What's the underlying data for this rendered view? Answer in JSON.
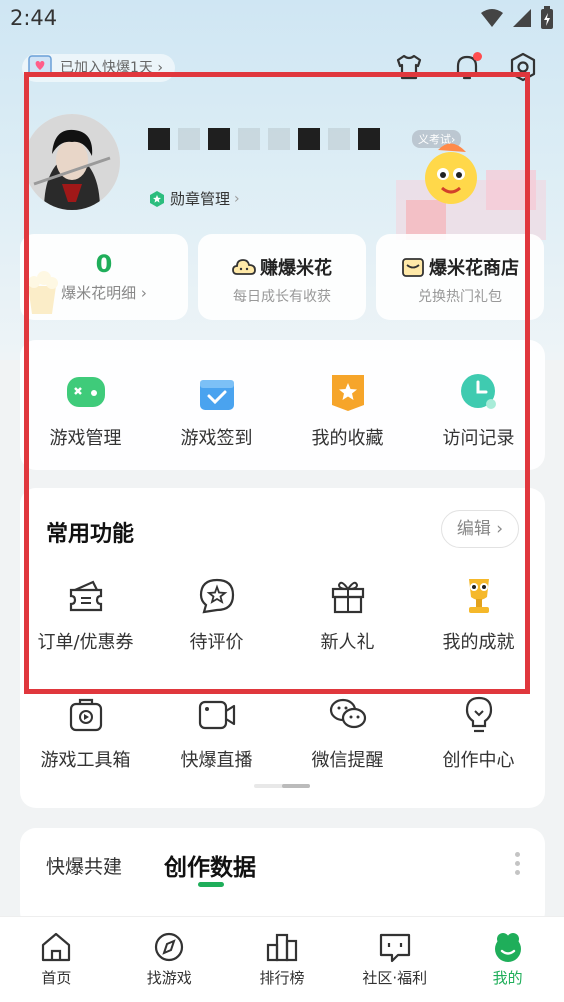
{
  "status_bar": {
    "time": "2:44"
  },
  "header": {
    "join_text": "已加入快爆1天 ›"
  },
  "profile": {
    "vip_tag": "义考试›",
    "medal_label": "勋章管理",
    "medal_arrow": "›"
  },
  "cards": {
    "popcorn_count": "0",
    "popcorn_detail": "爆米花明细 ›",
    "earn_title": "赚爆米花",
    "earn_sub": "每日成长有收获",
    "shop_title": "爆米花商店",
    "shop_sub": "兑换热门礼包"
  },
  "quick": [
    {
      "label": "游戏管理",
      "icon": "gamepad-icon"
    },
    {
      "label": "游戏签到",
      "icon": "gift-checkin-icon"
    },
    {
      "label": "我的收藏",
      "icon": "star-bookmark-icon"
    },
    {
      "label": "访问记录",
      "icon": "clock-history-icon"
    }
  ],
  "common": {
    "title": "常用功能",
    "edit_label": "编辑 ›",
    "row1": [
      {
        "label": "订单/优惠券",
        "icon": "coupon-icon"
      },
      {
        "label": "待评价",
        "icon": "review-star-icon"
      },
      {
        "label": "新人礼",
        "icon": "gift-box-icon"
      },
      {
        "label": "我的成就",
        "icon": "trophy-icon"
      }
    ],
    "row2": [
      {
        "label": "游戏工具箱",
        "icon": "toolbox-icon"
      },
      {
        "label": "快爆直播",
        "icon": "live-camera-icon"
      },
      {
        "label": "微信提醒",
        "icon": "wechat-icon"
      },
      {
        "label": "创作中心",
        "icon": "lightbulb-icon"
      }
    ]
  },
  "data_panel": {
    "tab_a": "快爆共建",
    "tab_b": "创作数据"
  },
  "bottom_nav": [
    {
      "label": "首页",
      "icon": "home-icon"
    },
    {
      "label": "找游戏",
      "icon": "compass-icon"
    },
    {
      "label": "排行榜",
      "icon": "ranking-icon"
    },
    {
      "label": "社区·福利",
      "icon": "community-icon"
    },
    {
      "label": "我的",
      "icon": "profile-icon"
    }
  ],
  "colors": {
    "accent": "#1fae5a",
    "highlight": "#e0373d",
    "badge": "#ff4d4f"
  }
}
